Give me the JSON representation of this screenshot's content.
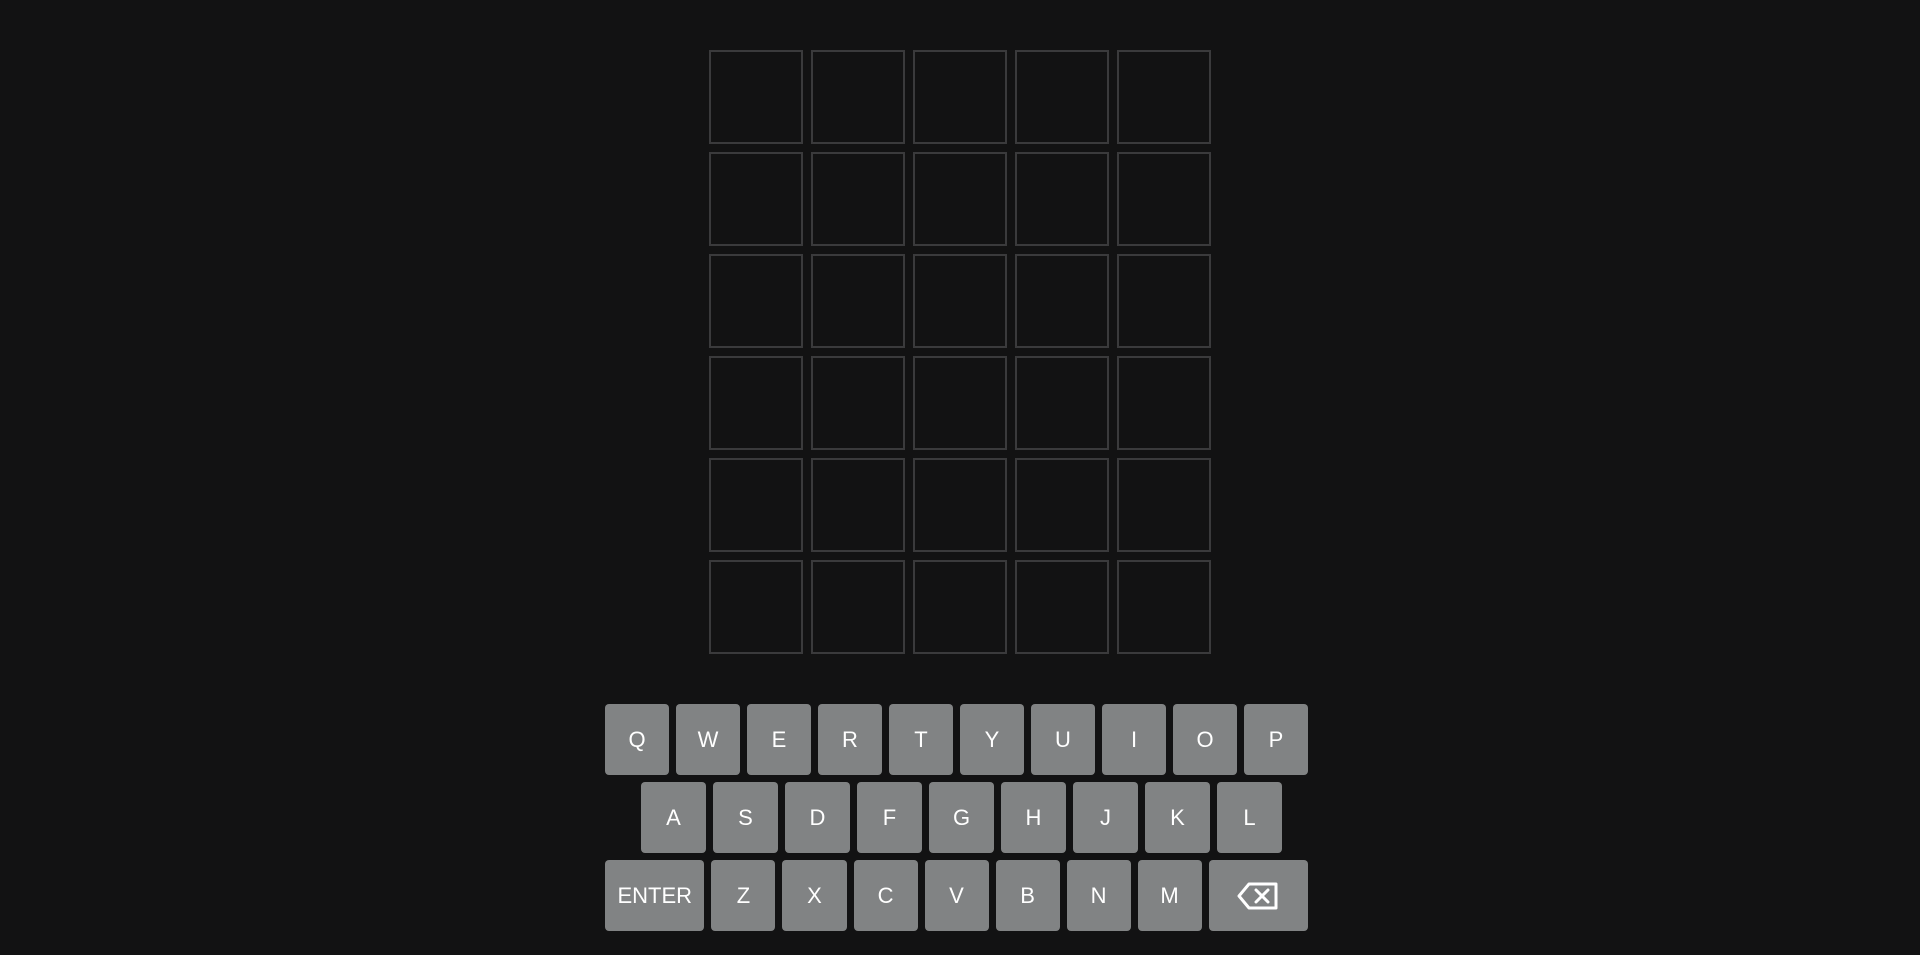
{
  "board": {
    "rows": [
      [
        "",
        "",
        "",
        "",
        ""
      ],
      [
        "",
        "",
        "",
        "",
        ""
      ],
      [
        "",
        "",
        "",
        "",
        ""
      ],
      [
        "",
        "",
        "",
        "",
        ""
      ],
      [
        "",
        "",
        "",
        "",
        ""
      ],
      [
        "",
        "",
        "",
        "",
        ""
      ]
    ]
  },
  "keyboard": {
    "row1": [
      "Q",
      "W",
      "E",
      "R",
      "T",
      "Y",
      "U",
      "I",
      "O",
      "P"
    ],
    "row2": [
      "A",
      "S",
      "D",
      "F",
      "G",
      "H",
      "J",
      "K",
      "L"
    ],
    "row3": [
      "Z",
      "X",
      "C",
      "V",
      "B",
      "N",
      "M"
    ],
    "enter_label": "ENTER",
    "backspace_icon": "backspace-icon"
  },
  "colors": {
    "background": "#121213",
    "tile_border": "#3a3a3c",
    "key": "#818384",
    "key_text": "#ffffff"
  }
}
